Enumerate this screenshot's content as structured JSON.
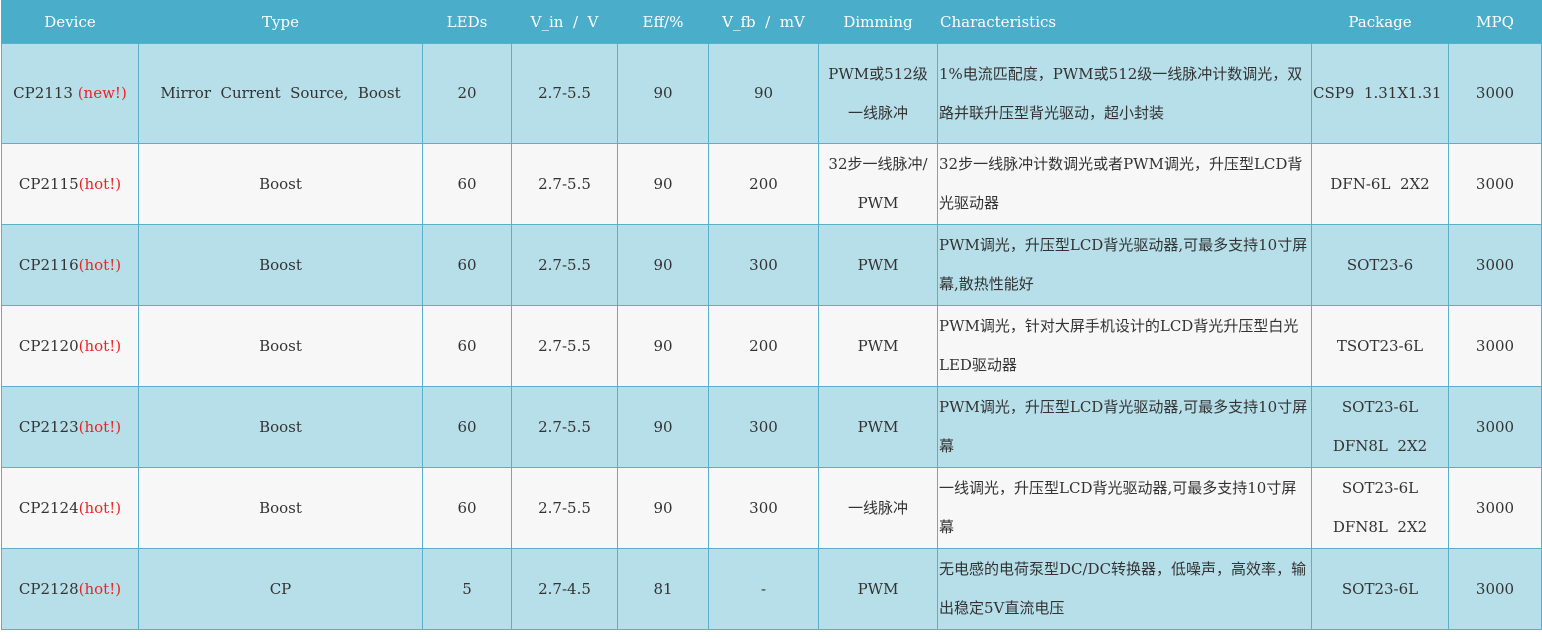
{
  "colors": {
    "header_bg": "#4aaecb",
    "row_odd": "#b7dfe9",
    "row_even": "#f7f7f7",
    "tag": "#ee2222",
    "border": "#5ab0c8"
  },
  "headers": {
    "device": "Device",
    "type": "Type",
    "leds": "LEDs",
    "vin": "V_in  /  V",
    "eff": "Eff/%",
    "vfb": "V_fb  /  mV",
    "dimming": "Dimming",
    "characteristics": "Characteristics",
    "package": "Package",
    "mpq": "MPQ"
  },
  "rows": [
    {
      "device": "CP2113",
      "tag": "  (new!)",
      "type": "Mirror  Current  Source,  Boost",
      "leds": "20",
      "vin": "2.7-5.5",
      "eff": "90",
      "vfb": "90",
      "dimming": "PWM或512级一线脉冲",
      "characteristics": "1%电流匹配度，PWM或512级一线脉冲计数调光，双路并联升压型背光驱动，超小封装",
      "package": "CSP9  1.31X1.31",
      "mpq": "3000"
    },
    {
      "device": "CP2115",
      "tag": "(hot!)",
      "type": "Boost",
      "leds": "60",
      "vin": "2.7-5.5",
      "eff": "90",
      "vfb": "200",
      "dimming": "32步一线脉冲/  PWM",
      "characteristics": "32步一线脉冲计数调光或者PWM调光，升压型LCD背光驱动器",
      "package": "DFN-6L  2X2",
      "mpq": "3000"
    },
    {
      "device": "CP2116",
      "tag": "(hot!)",
      "type": "Boost",
      "leds": "60",
      "vin": "2.7-5.5",
      "eff": "90",
      "vfb": "300",
      "dimming": "PWM",
      "characteristics": "PWM调光，升压型LCD背光驱动器,可最多支持10寸屏幕,散热性能好",
      "package": "SOT23-6",
      "mpq": "3000"
    },
    {
      "device": "CP2120",
      "tag": "(hot!)",
      "type": "Boost",
      "leds": "60",
      "vin": "2.7-5.5",
      "eff": "90",
      "vfb": "200",
      "dimming": "PWM",
      "characteristics": "PWM调光，针对大屏手机设计的LCD背光升压型白光LED驱动器",
      "package": "TSOT23-6L",
      "mpq": "3000"
    },
    {
      "device": "CP2123",
      "tag": "(hot!)",
      "type": "Boost",
      "leds": "60",
      "vin": "2.7-5.5",
      "eff": "90",
      "vfb": "300",
      "dimming": "PWM",
      "characteristics": "PWM调光，升压型LCD背光驱动器,可最多支持10寸屏幕",
      "package": "SOT23-6L\nDFN8L  2X2",
      "mpq": "3000"
    },
    {
      "device": "CP2124",
      "tag": "(hot!)",
      "type": "Boost",
      "leds": "60",
      "vin": "2.7-5.5",
      "eff": "90",
      "vfb": "300",
      "dimming": "一线脉冲",
      "characteristics": "一线调光，升压型LCD背光驱动器,可最多支持10寸屏幕",
      "package": "SOT23-6L\nDFN8L  2X2",
      "mpq": "3000"
    },
    {
      "device": "CP2128",
      "tag": "(hot!)",
      "type": "CP",
      "leds": "5",
      "vin": "2.7-4.5",
      "eff": "81",
      "vfb": "-",
      "dimming": "PWM",
      "characteristics": "无电感的电荷泵型DC/DC转换器，低噪声，高效率，输出稳定5V直流电压",
      "package": "SOT23-6L",
      "mpq": "3000"
    }
  ]
}
